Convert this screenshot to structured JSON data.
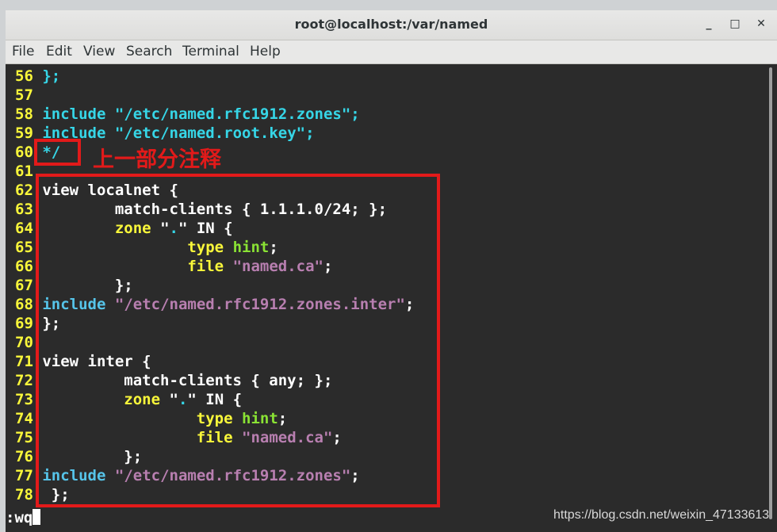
{
  "window": {
    "title": "root@localhost:/var/named"
  },
  "window_controls": {
    "minimize": "_",
    "maximize": "□",
    "close": "✕"
  },
  "menu": [
    "File",
    "Edit",
    "View",
    "Search",
    "Terminal",
    "Help"
  ],
  "lines": {
    "l56": {
      "num": "56",
      "code": "};"
    },
    "l57": {
      "num": "57"
    },
    "l58": {
      "num": "58",
      "kw": "include",
      "str": "\"/etc/named.rfc1912.zones\"",
      "end": ";"
    },
    "l59": {
      "num": "59",
      "kw": "include",
      "str": "\"/etc/named.root.key\"",
      "end": ";"
    },
    "l60": {
      "num": "60",
      "code": "*/"
    },
    "l61": {
      "num": "61"
    },
    "l62": {
      "num": "62",
      "code": "view localnet {"
    },
    "l63": {
      "num": "63",
      "code": "match-clients { 1.1.1.0/24; };"
    },
    "l64": {
      "num": "64",
      "kw": "zone",
      "q1": "\"",
      "dot": ".",
      "q2": "\"",
      "rest": " IN {"
    },
    "l65": {
      "num": "65",
      "kw": "type",
      "val": "hint",
      "end": ";"
    },
    "l66": {
      "num": "66",
      "kw": "file",
      "str": "\"named.ca\"",
      "end": ";"
    },
    "l67": {
      "num": "67",
      "code": "};"
    },
    "l68": {
      "num": "68",
      "kw": "include",
      "str": "\"/etc/named.rfc1912.zones.inter\"",
      "end": ";"
    },
    "l69": {
      "num": "69",
      "code": "};"
    },
    "l70": {
      "num": "70"
    },
    "l71": {
      "num": "71",
      "code": "view inter {"
    },
    "l72": {
      "num": "72",
      "code": "match-clients { any; };"
    },
    "l73": {
      "num": "73",
      "kw": "zone",
      "q1": "\"",
      "dot": ".",
      "q2": "\"",
      "rest": " IN {"
    },
    "l74": {
      "num": "74",
      "kw": "type",
      "val": "hint",
      "end": ";"
    },
    "l75": {
      "num": "75",
      "kw": "file",
      "str": "\"named.ca\"",
      "end": ";"
    },
    "l76": {
      "num": "76",
      "code": "};"
    },
    "l77": {
      "num": "77",
      "kw": "include",
      "str": "\"/etc/named.rfc1912.zones\"",
      "end": ";"
    },
    "l78": {
      "num": "78",
      "code": "};"
    }
  },
  "command_line": ":wq",
  "annotation": "上一部分注释",
  "watermark": "https://blog.csdn.net/weixin_47133613",
  "colors": {
    "annotation_red": "#e21a1a",
    "line_number_yellow": "#f9f73a",
    "keyword_cyan": "#36d6e7",
    "string_purple": "#b87fb0",
    "value_green": "#8ae234"
  }
}
